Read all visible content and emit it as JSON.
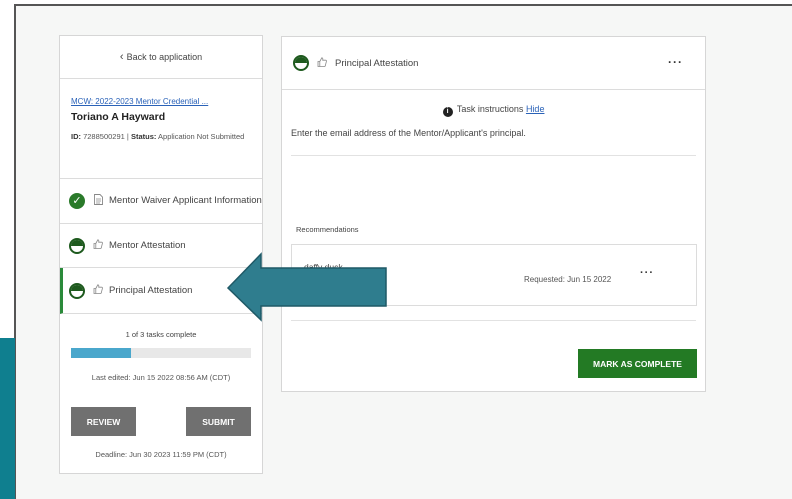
{
  "sidebar": {
    "back_label": "Back to application",
    "application_link": "MCW: 2022-2023 Mentor Credential ...",
    "applicant_name": "Toriano A Hayward",
    "id_label": "ID:",
    "id_value": "7288500291",
    "status_label": "Status:",
    "status_value": "Application Not Submitted",
    "tasks": [
      {
        "label": "Mentor Waiver Applicant Information",
        "status": "complete",
        "icon": "document-icon"
      },
      {
        "label": "Mentor Attestation",
        "status": "in-progress",
        "icon": "thumbs-up-icon"
      },
      {
        "label": "Principal Attestation",
        "status": "in-progress",
        "icon": "thumbs-up-icon"
      }
    ],
    "progress_text": "1 of 3 tasks complete",
    "progress_fraction": 0.333,
    "last_edited": "Last edited: Jun 15 2022 08:56 AM (CDT)",
    "review_label": "REVIEW",
    "submit_label": "SUBMIT",
    "deadline": "Deadline: Jun 30 2023 11:59 PM (CDT)"
  },
  "task_panel": {
    "title": "Principal Attestation",
    "instructions_label": "Task instructions",
    "hide_label": "Hide",
    "instructions_text": "Enter the email address of the Mentor/Applicant's principal.",
    "recommendations_label": "Recommendations",
    "recommendation": {
      "name": "daffy duck",
      "email_fragment": "la.gov",
      "requested": "Requested: Jun 15 2022"
    },
    "complete_label": "MARK AS COMPLETE"
  },
  "colors": {
    "accent_green": "#237a24",
    "progress_blue": "#4aa7cc",
    "arrow_teal": "#2f7d8e",
    "link_blue": "#2a62b8"
  }
}
